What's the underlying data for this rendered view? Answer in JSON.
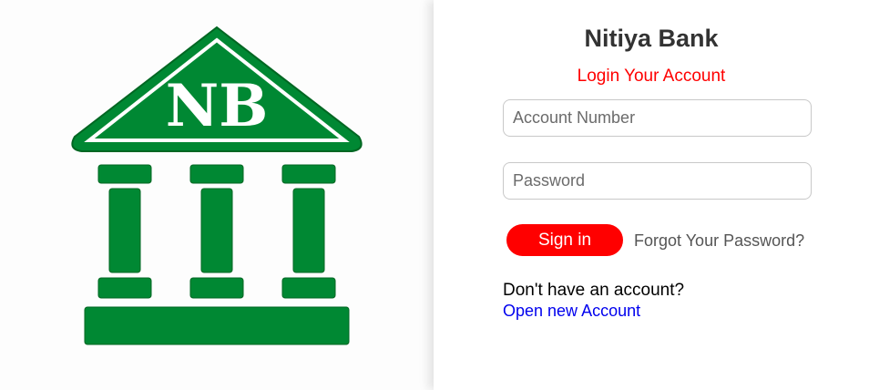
{
  "logo": {
    "text": "NB",
    "color": "#008833"
  },
  "login": {
    "title": "Nitiya Bank",
    "subtitle": "Login Your Account",
    "account_placeholder": "Account Number",
    "password_placeholder": "Password",
    "signin_label": "Sign in",
    "forgot_label": "Forgot Your Password?",
    "no_account_text": "Don't have an account?",
    "open_account_label": "Open new Account"
  },
  "colors": {
    "accent": "#ff0000",
    "link": "#0000ee",
    "brand_green": "#008833"
  }
}
